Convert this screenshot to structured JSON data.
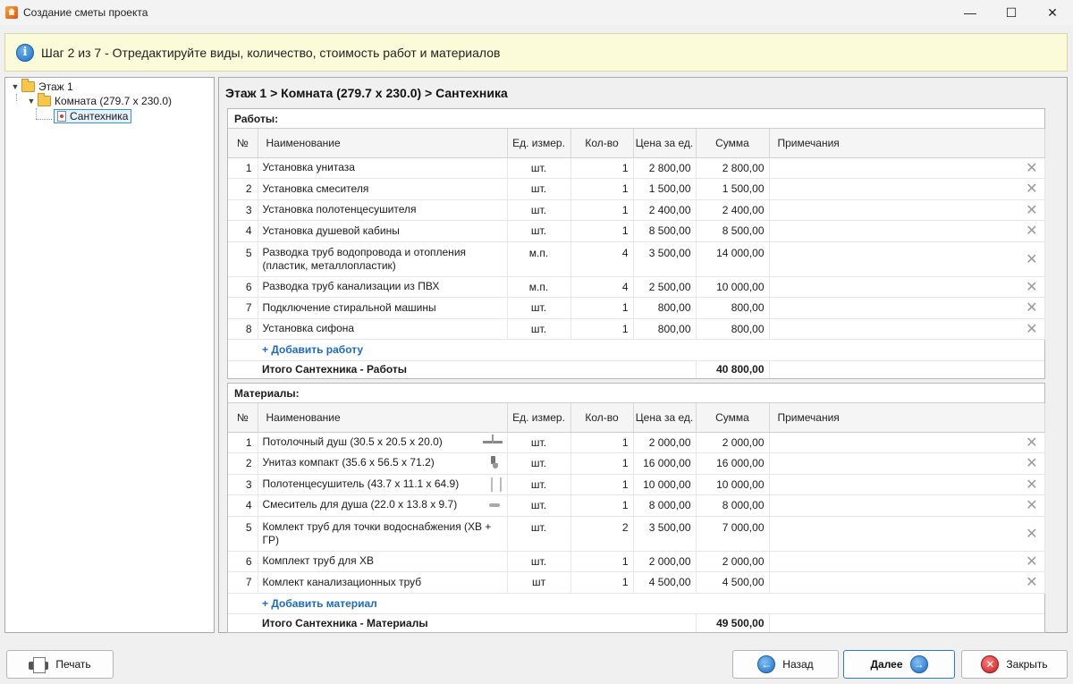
{
  "window": {
    "title": "Создание сметы проекта",
    "minimize_glyph": "—",
    "maximize_glyph": "☐",
    "close_glyph": "✕"
  },
  "banner": {
    "icon": "info-icon",
    "icon_glyph": "i",
    "text": "Шаг 2 из 7 - Отредактируйте виды, количество, стоимость работ и материалов"
  },
  "tree": {
    "floor": "Этаж 1",
    "room": "Комната (279.7 x 230.0)",
    "category": "Сантехника"
  },
  "breadcrumb": "Этаж 1 > Комната (279.7 x 230.0) > Сантехника",
  "columns": {
    "no": "№",
    "name": "Наименование",
    "unit": "Ед. измер.",
    "qty": "Кол-во",
    "price": "Цена за ед.",
    "sum": "Сумма",
    "notes": "Примечания"
  },
  "works": {
    "title": "Работы:",
    "rows": [
      {
        "no": "1",
        "name": "Установка унитаза",
        "unit": "шт.",
        "qty": "1",
        "price": "2 800,00",
        "sum": "2 800,00"
      },
      {
        "no": "2",
        "name": "Установка смесителя",
        "unit": "шт.",
        "qty": "1",
        "price": "1 500,00",
        "sum": "1 500,00"
      },
      {
        "no": "3",
        "name": "Установка полотенцесушителя",
        "unit": "шт.",
        "qty": "1",
        "price": "2 400,00",
        "sum": "2 400,00"
      },
      {
        "no": "4",
        "name": "Установка душевой кабины",
        "unit": "шт.",
        "qty": "1",
        "price": "8 500,00",
        "sum": "8 500,00"
      },
      {
        "no": "5",
        "name": "Разводка труб водопровода и отопления (пластик, металлопластик)",
        "unit": "м.п.",
        "qty": "4",
        "price": "3 500,00",
        "sum": "14 000,00"
      },
      {
        "no": "6",
        "name": "Разводка труб канализации из ПВХ",
        "unit": "м.п.",
        "qty": "4",
        "price": "2 500,00",
        "sum": "10 000,00"
      },
      {
        "no": "7",
        "name": "Подключение стиральной машины",
        "unit": "шт.",
        "qty": "1",
        "price": "800,00",
        "sum": "800,00"
      },
      {
        "no": "8",
        "name": "Установка сифона",
        "unit": "шт.",
        "qty": "1",
        "price": "800,00",
        "sum": "800,00"
      }
    ],
    "add_label": "+ Добавить работу",
    "total_label": "Итого Сантехника - Работы",
    "total_value": "40 800,00"
  },
  "materials": {
    "title": "Материалы:",
    "rows": [
      {
        "no": "1",
        "name": "Потолочный душ (30.5 x 20.5 x 20.0)",
        "icon": "shower-head-icon",
        "unit": "шт.",
        "qty": "1",
        "price": "2 000,00",
        "sum": "2 000,00"
      },
      {
        "no": "2",
        "name": "Унитаз компакт (35.6 x 56.5 x 71.2)",
        "icon": "toilet-icon",
        "unit": "шт.",
        "qty": "1",
        "price": "16 000,00",
        "sum": "16 000,00"
      },
      {
        "no": "3",
        "name": "Полотенцесушитель (43.7 x 11.1 x 64.9)",
        "icon": "towel-rail-icon",
        "unit": "шт.",
        "qty": "1",
        "price": "10 000,00",
        "sum": "10 000,00"
      },
      {
        "no": "4",
        "name": "Смеситель для душа (22.0 x 13.8 x 9.7)",
        "icon": "mixer-icon",
        "unit": "шт.",
        "qty": "1",
        "price": "8 000,00",
        "sum": "8 000,00"
      },
      {
        "no": "5",
        "name": "Комлект труб для точки водоснабжения (ХВ + ГР)",
        "icon": "",
        "unit": "шт.",
        "qty": "2",
        "price": "3 500,00",
        "sum": "7 000,00"
      },
      {
        "no": "6",
        "name": "Комплект труб для ХВ",
        "icon": "",
        "unit": "шт.",
        "qty": "1",
        "price": "2 000,00",
        "sum": "2 000,00"
      },
      {
        "no": "7",
        "name": "Комлект канализационных труб",
        "icon": "",
        "unit": "шт",
        "qty": "1",
        "price": "4 500,00",
        "sum": "4 500,00"
      }
    ],
    "add_label": "+ Добавить материал",
    "total_label": "Итого Сантехника - Материалы",
    "total_value": "49 500,00"
  },
  "delete_glyph": "✕",
  "buttons": {
    "print": "Печать",
    "back": "Назад",
    "back_glyph": "←",
    "next": "Далее",
    "next_glyph": "→",
    "close": "Закрыть",
    "close_glyph": "✕"
  },
  "colors": {
    "banner_bg": "#fbfbd9",
    "link": "#1c6bc2",
    "primary_border": "#2a7ad0"
  }
}
